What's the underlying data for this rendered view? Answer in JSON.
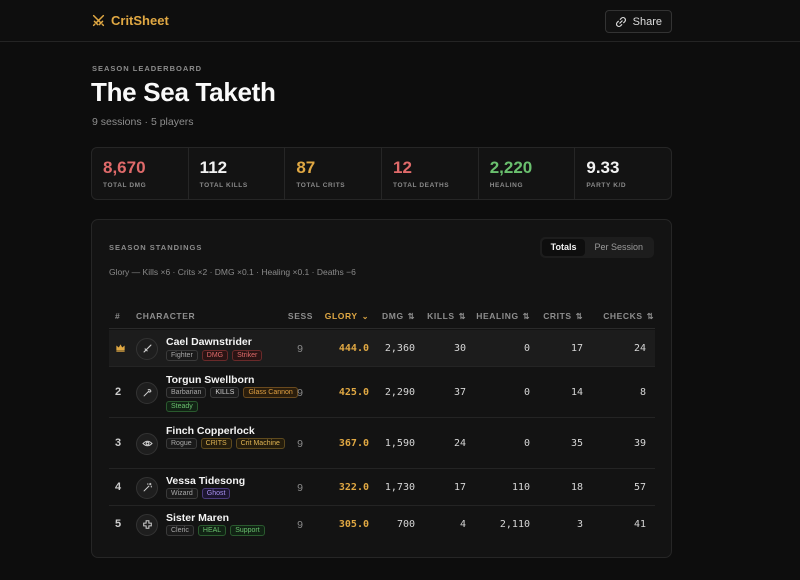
{
  "app": {
    "name": "CritSheet",
    "share_label": "Share"
  },
  "header": {
    "eyebrow": "SEASON LEADERBOARD",
    "title": "The Sea Taketh",
    "subtitle": "9 sessions · 5 players"
  },
  "stats": [
    {
      "value": "8,670",
      "label": "TOTAL DMG",
      "color": "#e06a6a"
    },
    {
      "value": "112",
      "label": "TOTAL KILLS",
      "color": "#f2f2f2"
    },
    {
      "value": "87",
      "label": "TOTAL CRITS",
      "color": "#e0a843"
    },
    {
      "value": "12",
      "label": "TOTAL DEATHS",
      "color": "#e06a6a"
    },
    {
      "value": "2,220",
      "label": "HEALING",
      "color": "#6ac06e"
    },
    {
      "value": "9.33",
      "label": "PARTY K/D",
      "color": "#f2f2f2"
    }
  ],
  "standings": {
    "title": "SEASON STANDINGS",
    "formula": "Glory — Kills ×6 · Crits ×2 · DMG ×0.1 · Healing ×0.1 · Deaths −6",
    "toggle": {
      "options": [
        "Totals",
        "Per Session"
      ],
      "selected": "Totals"
    },
    "columns": [
      "#",
      "CHARACTER",
      "SESS",
      "GLORY",
      "DMG",
      "KILLS",
      "HEALING",
      "CRITS",
      "CHECKS"
    ],
    "sorted_column": "GLORY",
    "rows": [
      {
        "rank": "",
        "rank_icon": "crown-icon",
        "avatar_icon": "sword-icon",
        "name": "Cael Dawnstrider",
        "class": "Fighter",
        "tags": [
          {
            "text": "DMG",
            "tone": "red"
          },
          {
            "text": "Striker",
            "tone": "red"
          }
        ],
        "sess": "9",
        "glory": "444.0",
        "dmg": "2,360",
        "kills": "30",
        "healing": "0",
        "crits": "17",
        "checks": "24"
      },
      {
        "rank": "2",
        "avatar_icon": "axe-icon",
        "name": "Torgun Swellborn",
        "class": "Barbarian",
        "tags": [
          {
            "text": "KILLS",
            "tone": "plain"
          },
          {
            "text": "Glass Cannon",
            "tone": "orange"
          },
          {
            "text": "Steady",
            "tone": "green"
          }
        ],
        "sess": "9",
        "glory": "425.0",
        "dmg": "2,290",
        "kills": "37",
        "healing": "0",
        "crits": "14",
        "checks": "8"
      },
      {
        "rank": "3",
        "avatar_icon": "eye-icon",
        "name": "Finch Copperlock",
        "class": "Rogue",
        "tags": [
          {
            "text": "CRITS",
            "tone": "gold"
          },
          {
            "text": "Crit Machine",
            "tone": "gold"
          }
        ],
        "sess": "9",
        "glory": "367.0",
        "dmg": "1,590",
        "kills": "24",
        "healing": "0",
        "crits": "35",
        "checks": "39"
      },
      {
        "rank": "4",
        "avatar_icon": "wand-icon",
        "name": "Vessa Tidesong",
        "class": "Wizard",
        "tags": [
          {
            "text": "Ghost",
            "tone": "purple"
          }
        ],
        "sess": "9",
        "glory": "322.0",
        "dmg": "1,730",
        "kills": "17",
        "healing": "110",
        "crits": "18",
        "checks": "57"
      },
      {
        "rank": "5",
        "avatar_icon": "plus-cross-icon",
        "name": "Sister Maren",
        "class": "Cleric",
        "tags": [
          {
            "text": "HEAL",
            "tone": "green"
          },
          {
            "text": "Support",
            "tone": "green"
          }
        ],
        "sess": "9",
        "glory": "305.0",
        "dmg": "700",
        "kills": "4",
        "healing": "2,110",
        "crits": "3",
        "checks": "41"
      }
    ]
  }
}
